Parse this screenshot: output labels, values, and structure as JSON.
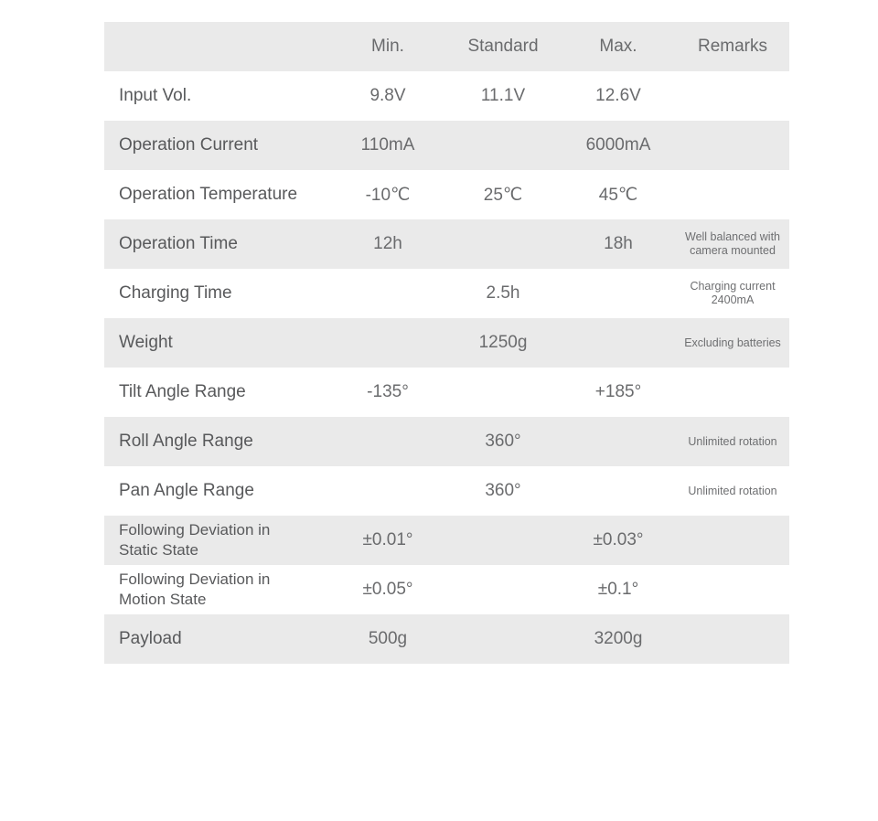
{
  "table": {
    "headers": {
      "label": "",
      "min": "Min.",
      "standard": "Standard",
      "max": "Max.",
      "remarks": "Remarks"
    },
    "colors": {
      "stripe_background": "#eaeaea",
      "plain_background": "#ffffff",
      "text": "#58595b",
      "value_text": "#6a6b6d",
      "remark_text": "#6e6f71"
    },
    "rows": [
      {
        "label": "Input Vol.",
        "min": "9.8V",
        "standard": "11.1V",
        "max": "12.6V",
        "remarks_line1": "",
        "remarks_line2": ""
      },
      {
        "label": "Operation Current",
        "min": "110mA",
        "standard": "",
        "max": "6000mA",
        "remarks_line1": "",
        "remarks_line2": ""
      },
      {
        "label": "Operation Temperature",
        "min": "-10℃",
        "standard": "25℃",
        "max": "45℃",
        "remarks_line1": "",
        "remarks_line2": ""
      },
      {
        "label": "Operation Time",
        "min": "12h",
        "standard": "",
        "max": "18h",
        "remarks_line1": "Well balanced with",
        "remarks_line2": "camera mounted"
      },
      {
        "label": "Charging Time",
        "min": "",
        "standard": "2.5h",
        "max": "",
        "remarks_line1": "Charging current",
        "remarks_line2": "2400mA"
      },
      {
        "label": "Weight",
        "min": "",
        "standard": "1250g",
        "max": "",
        "remarks_line1": "Excluding batteries",
        "remarks_line2": ""
      },
      {
        "label": "Tilt Angle Range",
        "min": "-135°",
        "standard": "",
        "max": "+185°",
        "remarks_line1": "",
        "remarks_line2": ""
      },
      {
        "label": "Roll Angle Range",
        "min": "",
        "standard": "360°",
        "max": "",
        "remarks_line1": "Unlimited rotation",
        "remarks_line2": ""
      },
      {
        "label": "Pan Angle Range",
        "min": "",
        "standard": "360°",
        "max": "",
        "remarks_line1": "Unlimited rotation",
        "remarks_line2": ""
      },
      {
        "label": "Following Deviation in Static State",
        "min": "±0.01°",
        "standard": "",
        "max": "±0.03°",
        "remarks_line1": "",
        "remarks_line2": ""
      },
      {
        "label": "Following Deviation in Motion State",
        "min": "±0.05°",
        "standard": "",
        "max": "±0.1°",
        "remarks_line1": "",
        "remarks_line2": ""
      },
      {
        "label": "Payload",
        "min": "500g",
        "standard": "",
        "max": "3200g",
        "remarks_line1": "",
        "remarks_line2": ""
      }
    ]
  }
}
